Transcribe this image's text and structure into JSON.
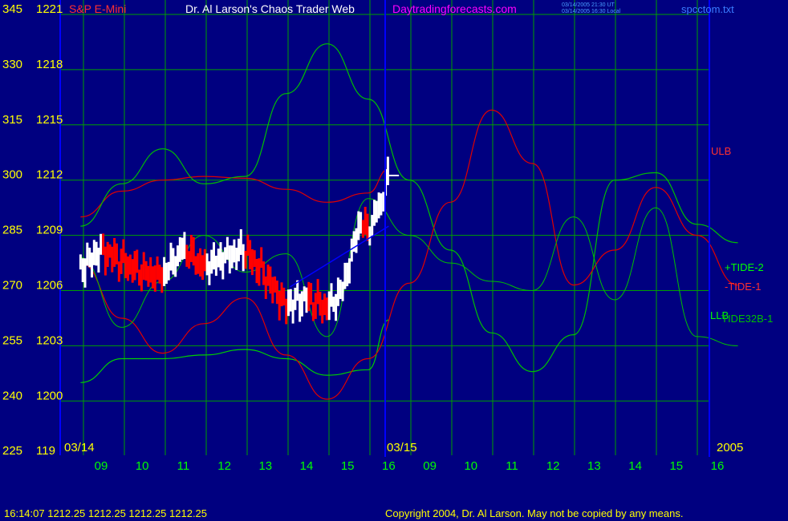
{
  "header": {
    "title_left": "S&P E-Mini",
    "title_center": "Dr. Al Larson's Chaos Trader Web",
    "site": "Daytradingforecasts.com",
    "utc_time": "03/14/2005 21:30 UT",
    "local_time": "03/14/2005 16:30 Local",
    "file": "spcctom.txt"
  },
  "footer": {
    "quote": "16:14:07  1212.25  1212.25  1212.25  1212.25",
    "copyright": "Copyright 2004, Dr. Al Larson. May not be copied by any means."
  },
  "colors": {
    "background": "#000080",
    "grid": "#00a000",
    "axis_yellow": "#ffff00",
    "time_green": "#00ff00",
    "price_up": "#ffffff",
    "price_down": "#ff0000",
    "tide_plus": "#00c000",
    "tide_minus": "#e00000",
    "ulb_llb": "#00d000",
    "blue_line": "#0000ff",
    "site_magenta": "#ff00ff",
    "label_blue": "#0060ff"
  },
  "chart_data": {
    "type": "line",
    "title": "S&P E-Mini",
    "y_axis_left": {
      "ticks": [
        "345",
        "330",
        "315",
        "300",
        "285",
        "270",
        "255",
        "240",
        "225"
      ]
    },
    "y_axis_price": {
      "ticks": [
        "1221",
        "1218",
        "1215",
        "1212",
        "1209",
        "1206",
        "1203",
        "1200",
        "119"
      ],
      "ylim": [
        1197,
        1221
      ]
    },
    "x_axis": {
      "hour_ticks": [
        "09",
        "10",
        "11",
        "12",
        "13",
        "14",
        "15",
        "16",
        "09",
        "10",
        "11",
        "12",
        "13",
        "14",
        "15",
        "16"
      ],
      "date_labels": [
        "03/14",
        "03/15"
      ],
      "year": "2005"
    },
    "series_labels": [
      "ULB",
      "+TIDE-2",
      "-TIDE-1",
      "LLB",
      "TIDE32B-1"
    ],
    "last_price": 1212.25,
    "grid": true,
    "series": [
      {
        "name": "ULB",
        "x": [
          8.5,
          9.5,
          10.5,
          11.5,
          12.5,
          13.5,
          14.5,
          15.5,
          16.0
        ],
        "y": [
          1210.0,
          1211.4,
          1212.0,
          1212.2,
          1212.1,
          1211.5,
          1210.8,
          1211.3,
          1212.6
        ]
      },
      {
        "name": "LLB",
        "x": [
          8.5,
          9.5,
          10.5,
          11.5,
          12.5,
          13.5,
          14.5,
          15.5,
          16.0
        ],
        "y": [
          1201.0,
          1202.3,
          1202.3,
          1202.5,
          1202.8,
          1202.3,
          1201.4,
          1201.7,
          1204.4
        ]
      },
      {
        "name": "+TIDE-2",
        "x": [
          8.5,
          9.5,
          10.5,
          11.5,
          12.5,
          13.5,
          14.5,
          15.5,
          16.5,
          17.5,
          18.5,
          19.5,
          20.5,
          21.5,
          22.5,
          23.5,
          24.5
        ],
        "y": [
          1209.5,
          1211.8,
          1213.7,
          1211.8,
          1212.2,
          1216.7,
          1219.4,
          1216.4,
          1212.0,
          1208.2,
          1203.7,
          1201.6,
          1203.6,
          1212.0,
          1212.4,
          1209.6,
          1208.6
        ]
      },
      {
        "name": "-TIDE-1",
        "x": [
          8.5,
          9.5,
          10.5,
          11.5,
          12.5,
          13.5,
          14.5,
          15.5,
          16.5,
          17.5,
          18.5,
          19.5,
          20.5,
          21.5,
          22.5,
          23.5,
          24.5
        ],
        "y": [
          1207.5,
          1204.5,
          1202.6,
          1204.2,
          1205.6,
          1202.5,
          1200.1,
          1202.3,
          1206.4,
          1210.8,
          1215.8,
          1212.9,
          1206.3,
          1208.2,
          1211.6,
          1209.0,
          1206.3
        ]
      },
      {
        "name": "TIDE32B-1",
        "x": [
          8.5,
          9.5,
          10.5,
          11.5,
          12.5,
          13.5,
          14.5,
          15.5,
          16.5,
          17.5,
          18.5,
          19.5,
          20.5,
          21.5,
          22.5,
          23.5,
          24.5
        ],
        "y": [
          1207.8,
          1204.0,
          1206.5,
          1209.0,
          1207.0,
          1208.0,
          1203.5,
          1211.0,
          1209.0,
          1207.5,
          1206.5,
          1206.0,
          1210.0,
          1205.5,
          1210.5,
          1203.5,
          1203.0
        ]
      },
      {
        "name": "Price",
        "x": [
          8.5,
          9.0,
          9.5,
          10.0,
          10.5,
          11.0,
          11.5,
          12.0,
          12.5,
          13.0,
          13.5,
          14.0,
          14.5,
          14.8,
          15.0,
          15.3,
          15.5,
          15.8,
          16.0,
          16.25
        ],
        "y": [
          1207.2,
          1208.2,
          1207.6,
          1207.0,
          1206.8,
          1208.3,
          1207.3,
          1207.8,
          1208.2,
          1206.8,
          1205.2,
          1205.6,
          1205.1,
          1205.7,
          1207.0,
          1209.8,
          1209.2,
          1210.7,
          1212.2,
          1212.25
        ]
      }
    ]
  }
}
